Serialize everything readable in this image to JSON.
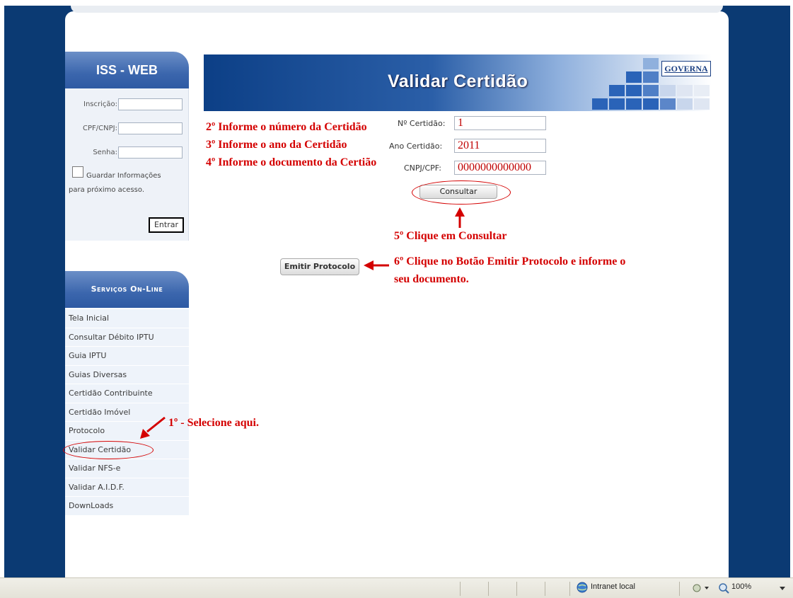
{
  "login": {
    "title": "ISS - WEB",
    "inscricao_label": "Inscrição:",
    "cpf_label": "CPF/CNPJ:",
    "senha_label": "Senha:",
    "remember_label": "Guardar Informações",
    "remember_sub": "para próximo acesso.",
    "enter_label": "Entrar"
  },
  "services": {
    "title": "Serviços On-Line",
    "items": [
      "Tela Inicial",
      "Consultar Débito IPTU",
      "Guia IPTU",
      "Guias Diversas",
      "Certidão Contribuinte",
      "Certidão Imóvel",
      "Protocolo",
      "Validar Certidão",
      "Validar NFS-e",
      "Validar A.I.D.F.",
      "DownLoads"
    ]
  },
  "banner": {
    "title": "Validar Certidão",
    "logo": "GOVERNA"
  },
  "form": {
    "numero_label": "Nº Certidão:",
    "numero_value": "1",
    "ano_label": "Ano Certidão:",
    "ano_value": "2011",
    "doc_label": "CNPJ/CPF:",
    "doc_value": "0000000000000",
    "consultar_label": "Consultar",
    "protocolo_label": "Emitir Protocolo"
  },
  "annotations": {
    "step2": "2º Informe o número da Certidão",
    "step3": "3º Informe o ano da Certidão",
    "step4": "4º Informe o documento da Certião",
    "step5": "5º Clique em Consultar",
    "step6_line1": "6º Clique no Botão Emitir Protocolo e informe o",
    "step6_line2": "seu documento.",
    "step1": "1º - Selecione aqui."
  },
  "statusbar": {
    "zone": "Intranet local",
    "zoom": "100%"
  },
  "colors": {
    "page_bg": "#0b3a73",
    "banner_dark": "#0c3f86",
    "annotation": "#d40000"
  }
}
